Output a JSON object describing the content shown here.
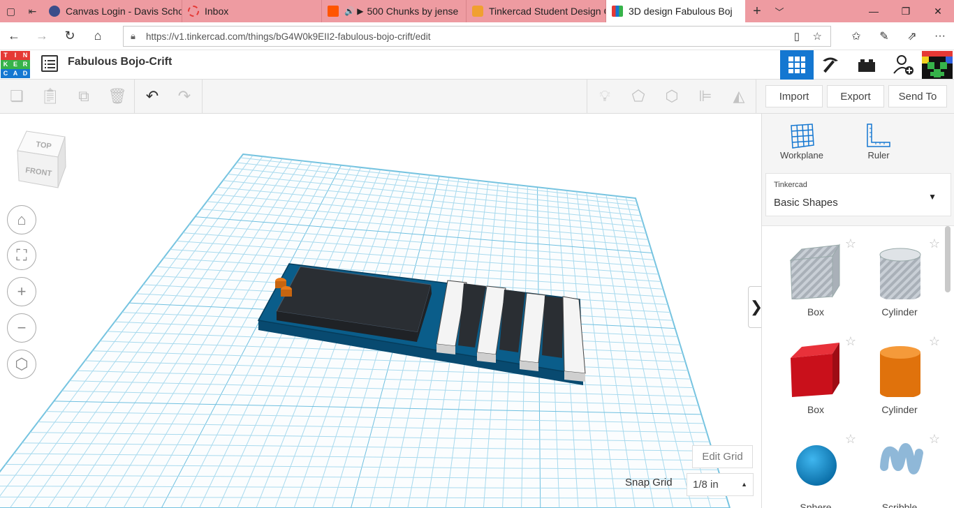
{
  "browser": {
    "tabs": [
      {
        "title": "Canvas Login - Davis Schoo",
        "fav_color": "#3b4d8a"
      },
      {
        "title": "Inbox",
        "fav_color": "#e53935"
      },
      {
        "title": "500 Chunks by jense",
        "fav_color": "#ff5500"
      },
      {
        "title": "Tinkercad Student Design C",
        "fav_color": "#f0a030"
      },
      {
        "title": "3D design Fabulous Boj",
        "fav_color": "#1477d1"
      }
    ],
    "tab_audio_glyph": "🔊 ▶",
    "url": "https://v1.tinkercad.com/things/bG4W0k9EII2-fabulous-bojo-crift/edit",
    "icons": [
      "back-icon",
      "forward-icon",
      "refresh-icon",
      "home-icon",
      "lock-icon",
      "reading-view-icon",
      "favorite-star-icon",
      "favorites-icon",
      "pen-icon",
      "share-icon",
      "more-icon"
    ]
  },
  "app": {
    "logo_letters": [
      "T",
      "I",
      "N",
      "K",
      "E",
      "R",
      "C",
      "A",
      "D"
    ],
    "title": "Fabulous Bojo-Crift",
    "header_icons": [
      "grid-view-icon",
      "pickaxe-icon",
      "lego-brick-icon",
      "add-user-icon",
      "avatar"
    ]
  },
  "toolbar": {
    "import_label": "Import",
    "export_label": "Export",
    "sendto_label": "Send To"
  },
  "viewport": {
    "view_cube": {
      "top": "TOP",
      "front": "FRONT"
    },
    "controls": [
      "home-view-icon",
      "fit-view-icon",
      "zoom-in-icon",
      "zoom-out-icon",
      "perspective-icon"
    ],
    "edit_grid_label": "Edit Grid",
    "snap_grid_label": "Snap Grid",
    "snap_grid_value": "1/8 in",
    "collapse_glyph": "❯",
    "colors": {
      "grid": "#9fd6ec",
      "base": "#0d6a9c",
      "dark": "#2a2e33",
      "keys": "#f4f4f4"
    }
  },
  "panel": {
    "workplane_label": "Workplane",
    "ruler_label": "Ruler",
    "library_category": "Tinkercad",
    "library_name": "Basic Shapes",
    "shapes": [
      {
        "label": "Box",
        "kind": "hole-box"
      },
      {
        "label": "Cylinder",
        "kind": "hole-cylinder"
      },
      {
        "label": "Box",
        "kind": "red-box"
      },
      {
        "label": "Cylinder",
        "kind": "orange-cylinder"
      },
      {
        "label": "Sphere",
        "kind": "sphere"
      },
      {
        "label": "Scribble",
        "kind": "scribble"
      }
    ]
  }
}
